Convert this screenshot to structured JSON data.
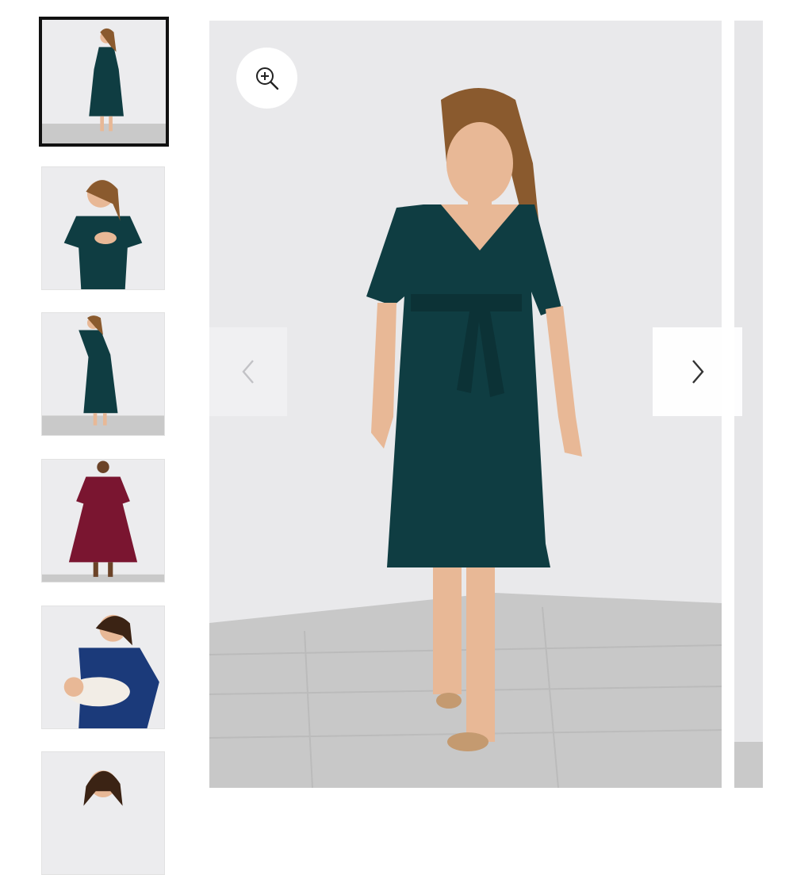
{
  "gallery": {
    "thumbnails": [
      {
        "icon": "dress-photo-front",
        "dress_color": "#0f3d42"
      },
      {
        "icon": "dress-photo-nursing",
        "dress_color": "#0f3d42"
      },
      {
        "icon": "dress-photo-side",
        "dress_color": "#0f3d42"
      },
      {
        "icon": "dress-photo-red",
        "dress_color": "#7a1530"
      },
      {
        "icon": "dress-photo-baby",
        "dress_color": "#1b3a7a"
      },
      {
        "icon": "dress-photo-partial",
        "dress_color": "#0f3d42"
      }
    ],
    "active_index": 0
  },
  "main_image": {
    "icon": "product-photo",
    "dress_color": "#0f3d42"
  },
  "controls": {
    "zoom_icon": "zoom-in-icon",
    "prev_icon": "chevron-left-icon",
    "next_icon": "chevron-right-icon"
  },
  "colors": {
    "wall": "#e9e9eb",
    "floor": "#c8c8c8",
    "dress_teal": "#0f3d42",
    "dress_burgundy": "#7a1530",
    "dress_navy": "#1b3a7a",
    "hair": "#8a5a2e",
    "skin": "#e8b896"
  }
}
